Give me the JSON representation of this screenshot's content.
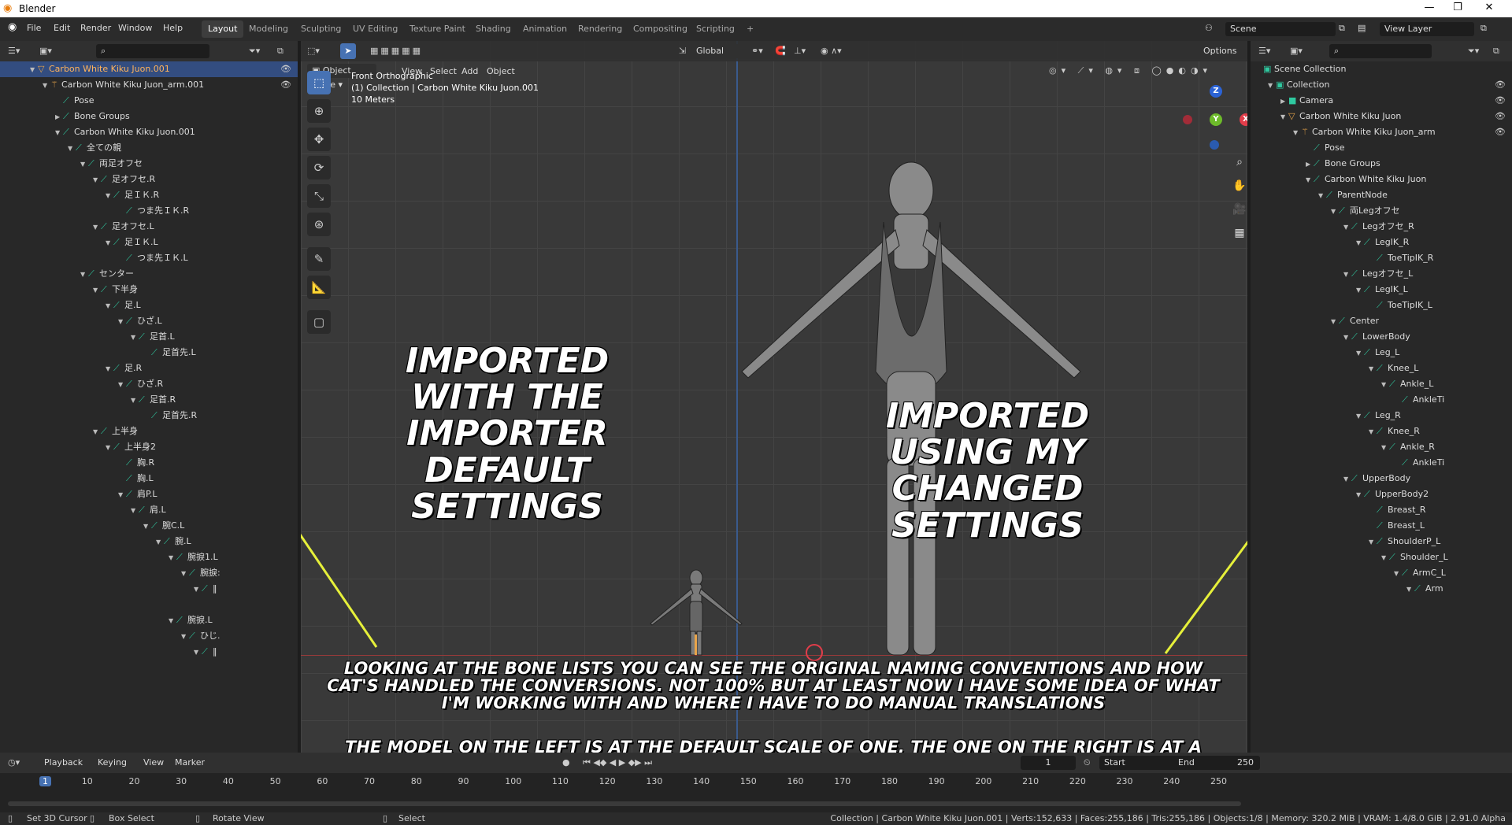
{
  "window": {
    "title": "Blender",
    "minimize": "—",
    "restore": "❐",
    "close": "✕"
  },
  "menu": [
    "File",
    "Edit",
    "Render",
    "Window",
    "Help"
  ],
  "workspaces": [
    "Layout",
    "Modeling",
    "Sculpting",
    "UV Editing",
    "Texture Paint",
    "Shading",
    "Animation",
    "Rendering",
    "Compositing",
    "Scripting",
    "+"
  ],
  "scene": {
    "label": "Scene",
    "view_layer": "View Layer"
  },
  "viewport": {
    "mode": "Object Mode",
    "menus": [
      "View",
      "Select",
      "Add",
      "Object"
    ],
    "transform": "Global",
    "options": "Options",
    "info_line1": "Front Orthographic",
    "info_line2": "(1) Collection | Carbon White Kiku Juon.001",
    "info_line3": "10 Meters"
  },
  "outliner_left": [
    {
      "d": 0,
      "t": "▼",
      "icon": "obj",
      "label": "Carbon White Kiku Juon.001",
      "eye": true,
      "sel": true
    },
    {
      "d": 1,
      "t": "▼",
      "icon": "ar",
      "label": "Carbon White Kiku Juon_arm.001",
      "eye": true
    },
    {
      "d": 2,
      "t": "",
      "icon": "bone",
      "label": "Pose"
    },
    {
      "d": 2,
      "t": "▶",
      "icon": "bone",
      "label": "Bone Groups"
    },
    {
      "d": 2,
      "t": "▼",
      "icon": "bone",
      "label": "Carbon White Kiku Juon.001"
    },
    {
      "d": 3,
      "t": "▼",
      "icon": "bone",
      "label": "全ての親"
    },
    {
      "d": 4,
      "t": "▼",
      "icon": "bone",
      "label": "両足オフセ"
    },
    {
      "d": 5,
      "t": "▼",
      "icon": "bone",
      "label": "足オフセ.R"
    },
    {
      "d": 6,
      "t": "▼",
      "icon": "bone",
      "label": "足ＩＫ.R"
    },
    {
      "d": 7,
      "t": "",
      "icon": "bone",
      "label": "つま先ＩＫ.R"
    },
    {
      "d": 5,
      "t": "▼",
      "icon": "bone",
      "label": "足オフセ.L"
    },
    {
      "d": 6,
      "t": "▼",
      "icon": "bone",
      "label": "足ＩＫ.L"
    },
    {
      "d": 7,
      "t": "",
      "icon": "bone",
      "label": "つま先ＩＫ.L"
    },
    {
      "d": 4,
      "t": "▼",
      "icon": "bone",
      "label": "センター"
    },
    {
      "d": 5,
      "t": "▼",
      "icon": "bone",
      "label": "下半身"
    },
    {
      "d": 6,
      "t": "▼",
      "icon": "bone",
      "label": "足.L"
    },
    {
      "d": 7,
      "t": "▼",
      "icon": "bone",
      "label": "ひざ.L"
    },
    {
      "d": 8,
      "t": "▼",
      "icon": "bone",
      "label": "足首.L"
    },
    {
      "d": 9,
      "t": "",
      "icon": "bone",
      "label": "足首先.L"
    },
    {
      "d": 6,
      "t": "▼",
      "icon": "bone",
      "label": "足.R"
    },
    {
      "d": 7,
      "t": "▼",
      "icon": "bone",
      "label": "ひざ.R"
    },
    {
      "d": 8,
      "t": "▼",
      "icon": "bone",
      "label": "足首.R"
    },
    {
      "d": 9,
      "t": "",
      "icon": "bone",
      "label": "足首先.R"
    },
    {
      "d": 5,
      "t": "▼",
      "icon": "bone",
      "label": "上半身"
    },
    {
      "d": 6,
      "t": "▼",
      "icon": "bone",
      "label": "上半身2"
    },
    {
      "d": 7,
      "t": "",
      "icon": "bone",
      "label": "胸.R"
    },
    {
      "d": 7,
      "t": "",
      "icon": "bone",
      "label": "胸.L"
    },
    {
      "d": 7,
      "t": "▼",
      "icon": "bone",
      "label": "肩P.L"
    },
    {
      "d": 8,
      "t": "▼",
      "icon": "bone",
      "label": "肩.L"
    },
    {
      "d": 9,
      "t": "▼",
      "icon": "bone",
      "label": "腕C.L"
    },
    {
      "d": 10,
      "t": "▼",
      "icon": "bone",
      "label": "腕.L"
    },
    {
      "d": 11,
      "t": "▼",
      "icon": "bone",
      "label": "腕捩1.L"
    },
    {
      "d": 12,
      "t": "▼",
      "icon": "bone",
      "label": "腕捩:"
    },
    {
      "d": 13,
      "t": "▼",
      "icon": "bone",
      "label": "‖"
    },
    {
      "d": 0,
      "t": "",
      "icon": "",
      "label": ""
    },
    {
      "d": 11,
      "t": "▼",
      "icon": "bone",
      "label": "腕捩.L"
    },
    {
      "d": 12,
      "t": "▼",
      "icon": "bone",
      "label": "ひじ."
    },
    {
      "d": 13,
      "t": "▼",
      "icon": "bone",
      "label": "‖"
    }
  ],
  "outliner_right": [
    {
      "d": 0,
      "t": "",
      "icon": "coll",
      "label": "Scene Collection"
    },
    {
      "d": 1,
      "t": "▼",
      "icon": "coll",
      "label": "Collection",
      "eye": true
    },
    {
      "d": 2,
      "t": "▶",
      "icon": "cam",
      "label": "Camera",
      "eye": true
    },
    {
      "d": 2,
      "t": "▼",
      "icon": "obj",
      "label": "Carbon White Kiku Juon",
      "eye": true
    },
    {
      "d": 3,
      "t": "▼",
      "icon": "ar",
      "label": "Carbon White Kiku Juon_arm",
      "eye": true
    },
    {
      "d": 4,
      "t": "",
      "icon": "bone",
      "label": "Pose"
    },
    {
      "d": 4,
      "t": "▶",
      "icon": "bone",
      "label": "Bone Groups"
    },
    {
      "d": 4,
      "t": "▼",
      "icon": "bone",
      "label": "Carbon White Kiku Juon"
    },
    {
      "d": 5,
      "t": "▼",
      "icon": "bone",
      "label": "ParentNode"
    },
    {
      "d": 6,
      "t": "▼",
      "icon": "bone",
      "label": "両Legオフセ"
    },
    {
      "d": 7,
      "t": "▼",
      "icon": "bone",
      "label": "Legオフセ_R"
    },
    {
      "d": 8,
      "t": "▼",
      "icon": "bone",
      "label": "LegIK_R"
    },
    {
      "d": 9,
      "t": "",
      "icon": "bone",
      "label": "ToeTipIK_R"
    },
    {
      "d": 7,
      "t": "▼",
      "icon": "bone",
      "label": "Legオフセ_L"
    },
    {
      "d": 8,
      "t": "▼",
      "icon": "bone",
      "label": "LegIK_L"
    },
    {
      "d": 9,
      "t": "",
      "icon": "bone",
      "label": "ToeTipIK_L"
    },
    {
      "d": 6,
      "t": "▼",
      "icon": "bone",
      "label": "Center"
    },
    {
      "d": 7,
      "t": "▼",
      "icon": "bone",
      "label": "LowerBody"
    },
    {
      "d": 8,
      "t": "▼",
      "icon": "bone",
      "label": "Leg_L"
    },
    {
      "d": 9,
      "t": "▼",
      "icon": "bone",
      "label": "Knee_L"
    },
    {
      "d": 10,
      "t": "▼",
      "icon": "bone",
      "label": "Ankle_L"
    },
    {
      "d": 11,
      "t": "",
      "icon": "bone",
      "label": "AnkleTi"
    },
    {
      "d": 8,
      "t": "▼",
      "icon": "bone",
      "label": "Leg_R"
    },
    {
      "d": 9,
      "t": "▼",
      "icon": "bone",
      "label": "Knee_R"
    },
    {
      "d": 10,
      "t": "▼",
      "icon": "bone",
      "label": "Ankle_R"
    },
    {
      "d": 11,
      "t": "",
      "icon": "bone",
      "label": "AnkleTi"
    },
    {
      "d": 7,
      "t": "▼",
      "icon": "bone",
      "label": "UpperBody"
    },
    {
      "d": 8,
      "t": "▼",
      "icon": "bone",
      "label": "UpperBody2"
    },
    {
      "d": 9,
      "t": "",
      "icon": "bone",
      "label": "Breast_R"
    },
    {
      "d": 9,
      "t": "",
      "icon": "bone",
      "label": "Breast_L"
    },
    {
      "d": 9,
      "t": "▼",
      "icon": "bone",
      "label": "ShoulderP_L"
    },
    {
      "d": 10,
      "t": "▼",
      "icon": "bone",
      "label": "Shoulder_L"
    },
    {
      "d": 11,
      "t": "▼",
      "icon": "bone",
      "label": "ArmC_L"
    },
    {
      "d": 12,
      "t": "▼",
      "icon": "bone",
      "label": "Arm"
    }
  ],
  "annotations": {
    "left": "Imported with the importer default settings",
    "right": "Imported using my changed settings",
    "bottom1": "Looking at the bone lists you can see the original naming conventions and how Cat's handled the conversions. Not 100% but at least now I have some idea of what I'm working with and where I have to do manual translations",
    "bottom2": "The model on the left is at the default scale of one, the one on the right is at a scale of four."
  },
  "timeline": {
    "menus": [
      "Playback",
      "Keying",
      "View",
      "Marker"
    ],
    "current": "1",
    "start_label": "Start",
    "start": "1",
    "end_label": "End",
    "end": "250",
    "ticks": [
      "1",
      "10",
      "20",
      "30",
      "40",
      "50",
      "60",
      "70",
      "80",
      "90",
      "100",
      "110",
      "120",
      "130",
      "140",
      "150",
      "160",
      "170",
      "180",
      "190",
      "200",
      "210",
      "220",
      "230",
      "240",
      "250"
    ]
  },
  "statusbar": {
    "left1": "Set 3D Cursor",
    "left2": "Box Select",
    "left3": "Rotate View",
    "left4": "Select",
    "right": "Collection | Carbon White Kiku Juon.001 | Verts:152,633 | Faces:255,186 | Tris:255,186 | Objects:1/8 | Memory: 320.2 MiB | VRAM: 1.4/8.0 GiB | 2.91.0 Alpha"
  },
  "colors": {
    "accent": "#4772b3",
    "bone": "#2fc9a0",
    "arrow": "#e6f03a"
  }
}
